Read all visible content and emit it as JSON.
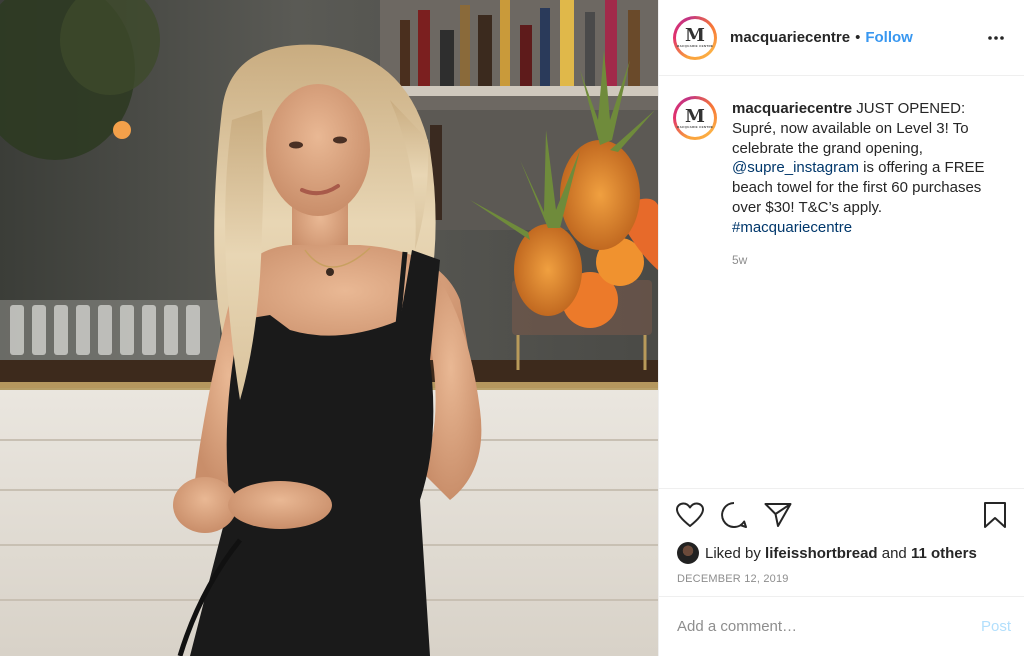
{
  "photo": {
    "alt_icon": "fashion-photo"
  },
  "header": {
    "avatar_letter": "M",
    "avatar_sub": "MACQUARIE CENTRE",
    "username": "macquariecentre",
    "dot": "•",
    "follow_label": "Follow",
    "more_icon": "more-options-icon"
  },
  "caption": {
    "username": "macquariecentre",
    "text_part1": " JUST OPENED: Supré, now available on Level 3! To celebrate the grand opening, ",
    "mention": "@supre_instagram",
    "text_part2": " is offering a FREE beach towel for the first 60 purchases over $30! T&C’s apply. ",
    "hashtag": "#macquariecentre",
    "time": "5w"
  },
  "actions": {
    "like_icon": "heart-icon",
    "comment_icon": "comment-icon",
    "share_icon": "share-icon",
    "save_icon": "bookmark-icon"
  },
  "likes": {
    "prefix": "Liked by ",
    "user": "lifeisshortbread",
    "middle": " and ",
    "others": "11 others"
  },
  "date": "DECEMBER 12, 2019",
  "comment": {
    "placeholder": "Add a comment…",
    "post_label": "Post"
  },
  "colors": {
    "accent": "#3897f0",
    "link": "#00376b",
    "muted": "#8e8e8e",
    "post_disabled": "#b2dffc"
  }
}
